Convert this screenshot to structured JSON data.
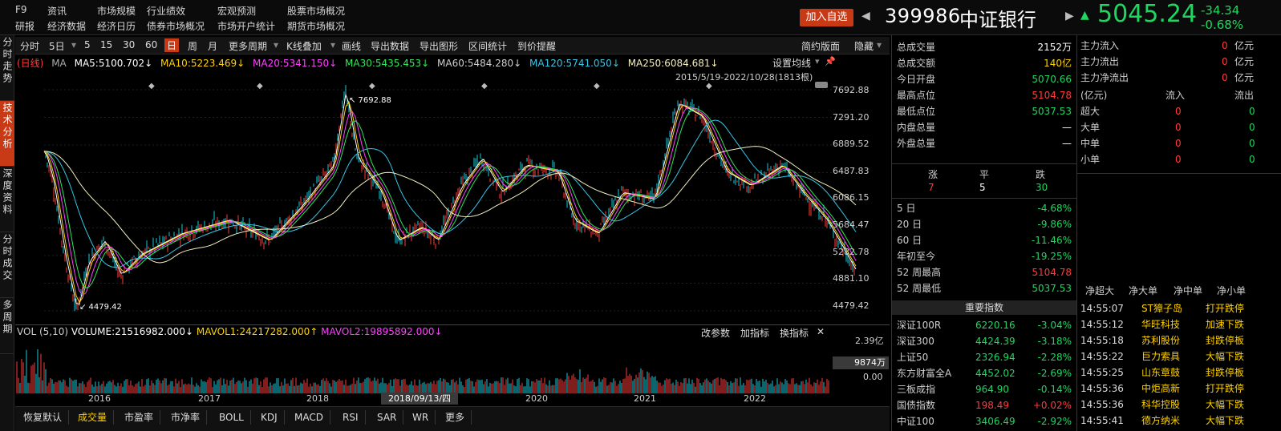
{
  "nav": {
    "row1": [
      "F9",
      "资讯",
      "市场规模",
      "行业绩效",
      "宏观预测",
      "股票市场概况"
    ],
    "row2": [
      "研报",
      "经济数据",
      "经济日历",
      "债券市场概况",
      "市场开户统计",
      "期货市场概况"
    ]
  },
  "header": {
    "add_fav": "加入自选",
    "code": "399986",
    "name": "中证银行",
    "price": "5045.24",
    "change": "-34.34",
    "change_pct": "-0.68%"
  },
  "left_tabs": [
    "分时走势",
    "技术分析",
    "深度资料",
    "分时成交",
    "多周期"
  ],
  "toolbar": {
    "items": [
      "分时",
      "5日",
      "5",
      "15",
      "30",
      "60",
      "日",
      "周",
      "月",
      "更多周期",
      "K线叠加",
      "画线",
      "导出数据",
      "导出图形",
      "区间统计",
      "到价提醒"
    ],
    "right": [
      "简约版面",
      "隐藏"
    ]
  },
  "ma_legend": {
    "prefix": "(日线)",
    "ma": "MA",
    "ma5": "MA5:5100.702↓",
    "ma10": "MA10:5223.469↓",
    "ma20": "MA20:5341.150↓",
    "ma30": "MA30:5435.453↓",
    "ma60": "MA60:5484.280↓",
    "ma120": "MA120:5741.050↓",
    "ma250": "MA250:6084.681↓",
    "settings": "设置均线"
  },
  "chart_meta": {
    "range": "2015/5/19-2022/10/28(1813根)",
    "high_label": "7692.88",
    "low_label": "4479.42",
    "y_ticks": [
      "7692.88",
      "7291.20",
      "6889.52",
      "6487.83",
      "6086.15",
      "5684.47",
      "5282.78",
      "4881.10",
      "4479.42"
    ],
    "x_ticks": [
      "2016",
      "2017",
      "2018",
      "2019",
      "2020",
      "2021",
      "2022"
    ],
    "cursor_date": "2018/09/13/四"
  },
  "volume": {
    "legend_prefix": "VOL (5,10)",
    "volume": "VOLUME:21516982.000↓",
    "mavol1": "MAVOL1:24217282.000↑",
    "mavol2": "MAVOL2:19895892.000↓",
    "actions": [
      "改参数",
      "加指标",
      "换指标",
      "✕"
    ],
    "y_top": "2.39亿",
    "y_mid": "9874万",
    "y_bottom": "0.00"
  },
  "bottom_tabs": [
    "恢复默认",
    "成交量",
    "市盈率",
    "市净率",
    "BOLL",
    "KDJ",
    "MACD",
    "RSI",
    "SAR",
    "WR",
    "更多"
  ],
  "quote": {
    "rows": [
      {
        "label": "总成交量",
        "value": "2152万",
        "color": "white"
      },
      {
        "label": "总成交额",
        "value": "140亿",
        "color": "yellow"
      },
      {
        "label": "今日开盘",
        "value": "5070.66",
        "color": "green"
      },
      {
        "label": "最高点位",
        "value": "5104.78",
        "color": "red"
      },
      {
        "label": "最低点位",
        "value": "5037.53",
        "color": "green"
      },
      {
        "label": "内盘总量",
        "value": "—",
        "color": "white"
      },
      {
        "label": "外盘总量",
        "value": "—",
        "color": "white"
      }
    ],
    "breadth_labels": [
      "涨",
      "平",
      "跌"
    ],
    "breadth_values": [
      "7",
      "5",
      "30"
    ],
    "periods": [
      {
        "label": "5 日",
        "value": "-4.68%"
      },
      {
        "label": "20 日",
        "value": "-9.86%"
      },
      {
        "label": "60 日",
        "value": "-11.46%"
      },
      {
        "label": "年初至今",
        "value": "-19.25%"
      },
      {
        "label": "52 周最高",
        "value": "5104.78"
      },
      {
        "label": "52 周最低",
        "value": "5037.53"
      }
    ],
    "index_title": "重要指数",
    "indices": [
      {
        "name": "深证100R",
        "value": "6220.16",
        "pct": "-3.04%",
        "color": "green"
      },
      {
        "name": "深证300",
        "value": "4424.39",
        "pct": "-3.18%",
        "color": "green"
      },
      {
        "name": "上证50",
        "value": "2326.94",
        "pct": "-2.28%",
        "color": "green"
      },
      {
        "name": "东方财富全A",
        "value": "4452.02",
        "pct": "-2.69%",
        "color": "green"
      },
      {
        "name": "三板成指",
        "value": "964.90",
        "pct": "-0.14%",
        "color": "green"
      },
      {
        "name": "国债指数",
        "value": "198.49",
        "pct": "+0.02%",
        "color": "red"
      },
      {
        "name": "中证100",
        "value": "3406.49",
        "pct": "-2.92%",
        "color": "green"
      }
    ]
  },
  "flow": {
    "top": [
      {
        "label": "主力流入",
        "value": "0",
        "unit": "亿元"
      },
      {
        "label": "主力流出",
        "value": "0",
        "unit": "亿元"
      },
      {
        "label": "主力净流出",
        "value": "0",
        "unit": "亿元"
      }
    ],
    "table_header": [
      "(亿元)",
      "流入",
      "流出"
    ],
    "table": [
      {
        "label": "超大",
        "in": "0",
        "out": "0"
      },
      {
        "label": "大单",
        "in": "0",
        "out": "0"
      },
      {
        "label": "中单",
        "in": "0",
        "out": "0"
      },
      {
        "label": "小单",
        "in": "0",
        "out": "0"
      }
    ],
    "net_header": [
      "净超大",
      "净大单",
      "净中单",
      "净小单"
    ],
    "ticks": [
      {
        "time": "14:55:07",
        "name": "ST獐子岛",
        "status": "打开跌停"
      },
      {
        "time": "14:55:12",
        "name": "华旺科技",
        "status": "加速下跌"
      },
      {
        "time": "14:55:18",
        "name": "苏利股份",
        "status": "封跌停板"
      },
      {
        "time": "14:55:22",
        "name": "巨力索具",
        "status": "大幅下跌"
      },
      {
        "time": "14:55:25",
        "name": "山东章鼓",
        "status": "封跌停板"
      },
      {
        "time": "14:55:36",
        "name": "中炬高新",
        "status": "打开跌停"
      },
      {
        "time": "14:55:36",
        "name": "科华控股",
        "status": "大幅下跌"
      },
      {
        "time": "14:55:41",
        "name": "德方纳米",
        "status": "大幅下跌"
      }
    ]
  }
}
